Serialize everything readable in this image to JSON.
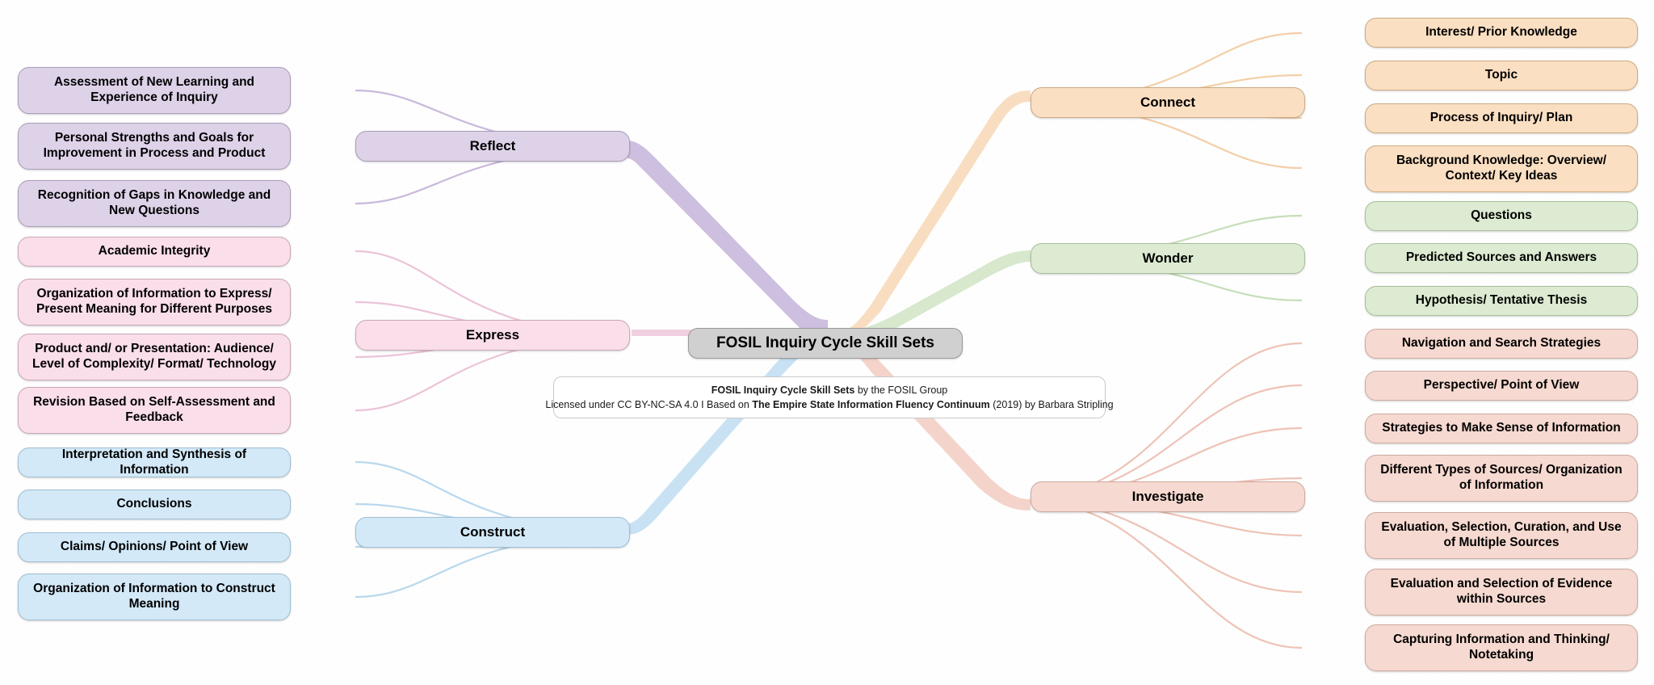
{
  "diagram": {
    "title": "FOSIL Inquiry Cycle Skill Sets",
    "type": "mind-map",
    "background_color": "#fefefe"
  },
  "center": {
    "label": "FOSIL Inquiry Cycle Skill Sets",
    "color": "#d0d0d0"
  },
  "license": {
    "line1_bold": "FOSIL Inquiry Cycle Skill Sets",
    "line1_rest": " by the FOSIL Group",
    "line2_a": "Licensed under CC BY-NC-SA 4.0 I Based on ",
    "line2_bold": "The Empire State Information Fluency Continuum",
    "line2_rest": " (2019) by Barbara Stripling"
  },
  "branches": [
    {
      "id": "reflect",
      "label": "Reflect",
      "color": "#ded2e9",
      "side": "left",
      "children": [
        {
          "label": "Assessment of New Learning and Experience of Inquiry"
        },
        {
          "label": "Personal Strengths and Goals for Improvement in Process and Product"
        },
        {
          "label": "Recognition of Gaps in Knowledge and New Questions"
        }
      ]
    },
    {
      "id": "express",
      "label": "Express",
      "color": "#fadeea",
      "side": "left",
      "children": [
        {
          "label": "Academic Integrity"
        },
        {
          "label": "Organization of Information to Express/ Present Meaning for Different Purposes"
        },
        {
          "label": "Product and/ or Presentation: Audience/ Level of Complexity/ Format/ Technology"
        },
        {
          "label": "Revision Based on Self-Assessment and Feedback"
        }
      ]
    },
    {
      "id": "construct",
      "label": "Construct",
      "color": "#d3e9f8",
      "side": "left",
      "children": [
        {
          "label": "Interpretation and Synthesis of Information"
        },
        {
          "label": "Conclusions"
        },
        {
          "label": "Claims/ Opinions/ Point of View"
        },
        {
          "label": "Organization of Information to Construct Meaning"
        }
      ]
    },
    {
      "id": "connect",
      "label": "Connect",
      "color": "#fbdfc2",
      "side": "right",
      "children": [
        {
          "label": "Interest/ Prior Knowledge"
        },
        {
          "label": "Topic"
        },
        {
          "label": "Process of Inquiry/ Plan"
        },
        {
          "label": "Background Knowledge: Overview/ Context/ Key Ideas"
        }
      ]
    },
    {
      "id": "wonder",
      "label": "Wonder",
      "color": "#dcebd1",
      "side": "right",
      "children": [
        {
          "label": "Questions"
        },
        {
          "label": "Predicted Sources and Answers"
        },
        {
          "label": "Hypothesis/ Tentative Thesis"
        }
      ]
    },
    {
      "id": "investigate",
      "label": "Investigate",
      "color": "#f6d9d0",
      "side": "right",
      "children": [
        {
          "label": "Navigation and Search Strategies"
        },
        {
          "label": "Perspective/ Point of View"
        },
        {
          "label": "Strategies to Make Sense of Information"
        },
        {
          "label": "Different Types of Sources/ Organization of Information"
        },
        {
          "label": "Evaluation, Selection, Curation, and Use of Multiple Sources"
        },
        {
          "label": "Evaluation and Selection of Evidence within Sources"
        },
        {
          "label": "Capturing Information and Thinking/ Notetaking"
        }
      ]
    }
  ]
}
